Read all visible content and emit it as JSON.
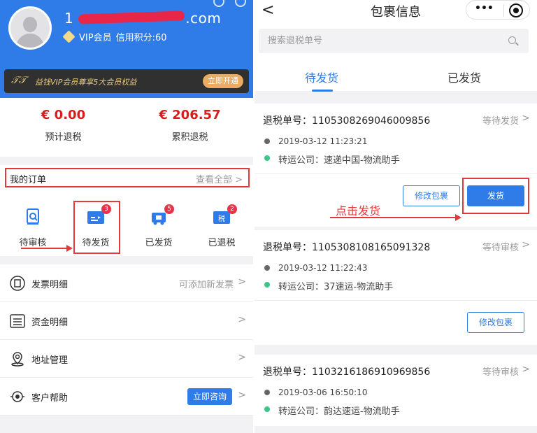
{
  "profile": {
    "email_prefix": "1",
    "email_suffix": ".com",
    "vip_label": "VIP会员",
    "credit_label": "信用积分:60"
  },
  "vip_banner": {
    "logo": "𝒯𝒯",
    "text": "益钱VIP会员尊享5大会员权益",
    "open_button": "立即开通"
  },
  "tax": {
    "estimated_value": "€ 0.00",
    "estimated_label": "预计退税",
    "total_value": "€ 206.57",
    "total_label": "累积退税"
  },
  "orders": {
    "title": "我的订单",
    "view_all": "查看全部 >",
    "items": [
      {
        "label": "待审核",
        "icon": "review-icon",
        "badge": ""
      },
      {
        "label": "待发货",
        "icon": "pending-ship-icon",
        "badge": "3"
      },
      {
        "label": "已发货",
        "icon": "shipped-icon",
        "badge": "5"
      },
      {
        "label": "已退税",
        "icon": "tax-refunded-icon",
        "badge": "2"
      }
    ]
  },
  "menu": [
    {
      "label": "发票明细",
      "extra": "可添加新发票",
      "icon": "invoice-icon"
    },
    {
      "label": "资金明细",
      "extra": "",
      "icon": "funds-icon"
    },
    {
      "label": "地址管理",
      "extra": "",
      "icon": "location-icon"
    },
    {
      "label": "客户帮助",
      "extra": "",
      "icon": "help-icon",
      "button": "立即咨询"
    }
  ],
  "right": {
    "back": "<",
    "title": "包裹信息",
    "capsule_dots": "•••",
    "search_placeholder": "搜索退税单号",
    "tabs": [
      "待发货",
      "已发货"
    ],
    "click_hint": "点击发货",
    "cards": [
      {
        "no": "退税单号：1105308269046009856",
        "status": "等待发货",
        "time": "2019-03-12 11:23:21",
        "carrier": "转运公司：速递中国-物流助手",
        "edit_label": "修改包裹",
        "ship_label": "发货"
      },
      {
        "no": "退税单号：1105308108165091328",
        "status": "等待审核",
        "time": "2019-03-12 11:22:43",
        "carrier": "转运公司：37速运-物流助手",
        "edit_label": "修改包裹"
      },
      {
        "no": "退税单号：1103216186910969856",
        "status": "等待审核",
        "time": "2019-03-06 16:50:10",
        "carrier": "转运公司：韵达速运-物流助手"
      }
    ]
  },
  "colors": {
    "primary": "#2f7ce8",
    "price_red": "#d91c1c",
    "annotation_red": "#e23a3a",
    "vip_gold": "#e4c67d"
  }
}
